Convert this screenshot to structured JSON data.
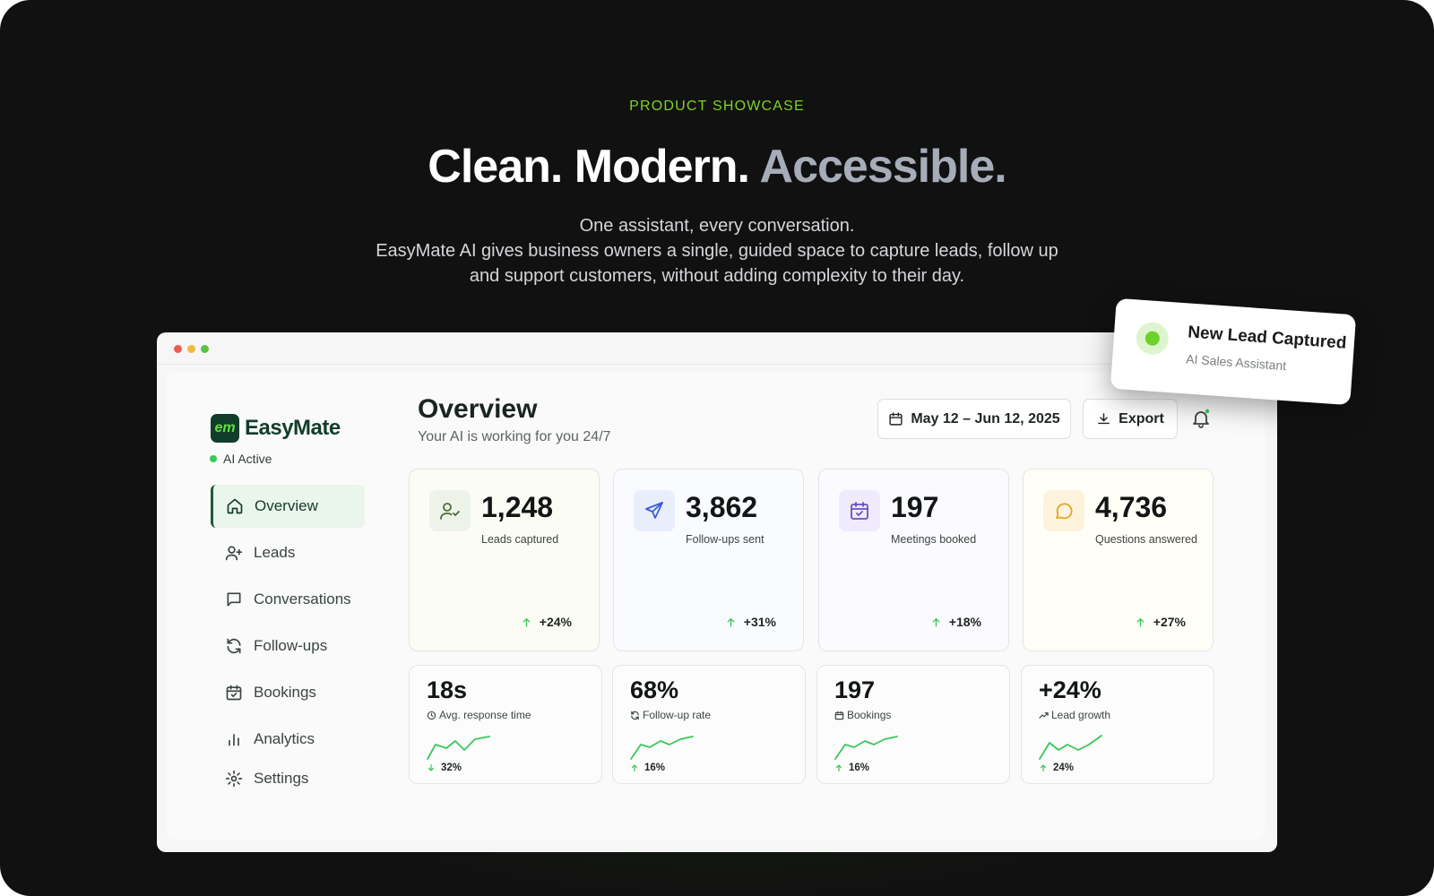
{
  "hero": {
    "eyebrow": "PRODUCT SHOWCASE",
    "headline_main": "Clean. Modern. ",
    "headline_accent": "Accessible.",
    "subtext": [
      "One assistant, every conversation.",
      "EasyMate AI gives business owners a single, guided space to capture leads, follow up",
      "and support customers, without adding complexity to their day."
    ]
  },
  "app": {
    "brand": {
      "name": "EasyMate",
      "mark": "em",
      "status": "AI Active"
    },
    "nav": [
      {
        "label": "Overview",
        "icon": "home-icon",
        "active": true
      },
      {
        "label": "Leads",
        "icon": "user-plus-icon"
      },
      {
        "label": "Conversations",
        "icon": "message-square-icon"
      },
      {
        "label": "Follow-ups",
        "icon": "refresh-icon"
      },
      {
        "label": "Bookings",
        "icon": "calendar-check-icon"
      },
      {
        "label": "Analytics",
        "icon": "bar-chart-icon"
      },
      {
        "label": "Settings",
        "icon": "gear-icon"
      }
    ],
    "header": {
      "title": "Overview",
      "subtitle": "Your AI is working for you 24/7",
      "date_range": "May 12 – Jun 12, 2025",
      "export_label": "Export"
    },
    "stats": [
      {
        "value": "1,248",
        "label": "Leads captured",
        "delta": "+24%",
        "icon": "user-check-icon",
        "tint": "#eef3e9",
        "card_bg": "#fbfcf4",
        "icon_color": "#4b6b3a"
      },
      {
        "value": "3,862",
        "label": "Follow-ups sent",
        "delta": "+31%",
        "icon": "send-icon",
        "tint": "#e8eefc",
        "card_bg": "#fafbfe",
        "icon_color": "#3b5bd9"
      },
      {
        "value": "197",
        "label": "Meetings booked",
        "delta": "+18%",
        "icon": "calendar-icon",
        "tint": "#efeafc",
        "card_bg": "#fbfafe",
        "icon_color": "#6a4fc9"
      },
      {
        "value": "4,736",
        "label": "Questions answered",
        "delta": "+27%",
        "icon": "chat-bubble-icon",
        "tint": "#fdf3dc",
        "card_bg": "#fffef7",
        "icon_color": "#e0a526"
      }
    ],
    "metrics": [
      {
        "value": "18s",
        "label": "Avg. response time",
        "icon": "clock-icon",
        "delta": "32%",
        "direction": "down"
      },
      {
        "value": "68%",
        "label": "Follow-up rate",
        "icon": "refresh-icon",
        "delta": "16%",
        "direction": "up"
      },
      {
        "value": "197",
        "label": "Bookings",
        "icon": "calendar-icon",
        "delta": "16%",
        "direction": "up"
      },
      {
        "value": "+24%",
        "label": "Lead growth",
        "icon": "trending-up-icon",
        "delta": "24%",
        "direction": "up"
      }
    ],
    "colors": {
      "accent": "#7ed321",
      "brand_dark": "#123d2b",
      "positive": "#3ac75a"
    }
  },
  "toast": {
    "title": "New Lead Captured",
    "subtitle": "AI Sales Assistant"
  }
}
